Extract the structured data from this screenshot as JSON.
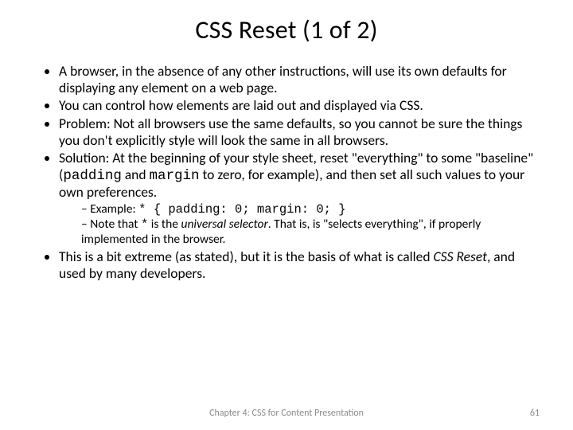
{
  "title": "CSS Reset (1 of 2)",
  "b1": "A browser, in the absence of any other instructions, will use its own defaults for displaying any element on a web page.",
  "b2": "You can control how elements are laid out and displayed via CSS.",
  "b3": "Problem: Not all browsers use the same defaults, so you cannot be sure the things you don't explicitly style will look the same in all browsers.",
  "b4_a": "Solution: At the beginning of your style sheet, reset \"everything\" to some \"baseline\" (",
  "b4_code1": "padding",
  "b4_b": " and ",
  "b4_code2": "margin",
  "b4_c": " to zero, for example), and then set all such values to your own preferences.",
  "s1_a": "Example: ",
  "s1_code": "* { padding: 0; margin: 0; }",
  "s2_a": "Note that ",
  "s2_code": "*",
  "s2_b": " is the ",
  "s2_ital": "universal selector",
  "s2_c": ". That is, is \"selects everything\", if properly implemented in the browser.",
  "b5_a": "This is a bit extreme (as stated), but it is the basis of what is called ",
  "b5_ital": "CSS Reset",
  "b5_b": ", and used by many developers.",
  "footer_center": "Chapter 4: CSS for Content Presentation",
  "footer_page": "61"
}
